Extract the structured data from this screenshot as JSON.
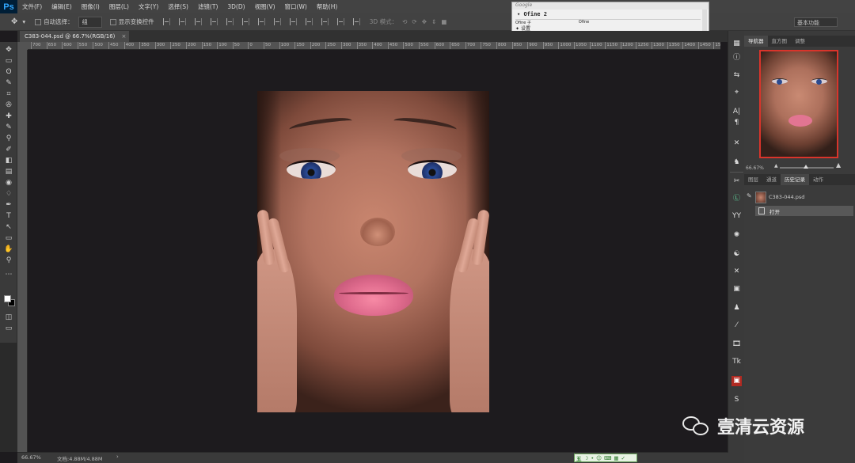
{
  "app": {
    "logo": "Ps"
  },
  "menu": [
    "文件(F)",
    "编辑(E)",
    "图像(I)",
    "图层(L)",
    "文字(Y)",
    "选择(S)",
    "滤镜(T)",
    "3D(D)",
    "视图(V)",
    "窗口(W)",
    "帮助(H)"
  ],
  "options": {
    "auto_select_label": "自动选择：",
    "auto_select_value": "组",
    "show_transform_label": "显示变换控件",
    "mode_3d": "3D 模式：",
    "workspace": "基本功能"
  },
  "ime": {
    "title": "Google",
    "composition": "Ofine 2",
    "candidates": [
      "Ofine 子",
      "Ofine"
    ],
    "settings": "设置"
  },
  "document": {
    "tab_title": "C383-044.psd @ 66.7%(RGB/16)",
    "close_icon": "×"
  },
  "ruler_ticks": [
    "700",
    "650",
    "600",
    "550",
    "500",
    "450",
    "400",
    "350",
    "300",
    "250",
    "200",
    "150",
    "100",
    "50",
    "0",
    "50",
    "100",
    "150",
    "200",
    "250",
    "300",
    "350",
    "400",
    "450",
    "500",
    "550",
    "600",
    "650",
    "700",
    "750",
    "800",
    "850",
    "900",
    "950",
    "1000",
    "1050",
    "1100",
    "1150",
    "1200",
    "1250",
    "1300",
    "1350",
    "1400",
    "1450",
    "1500"
  ],
  "panels": {
    "top_tabs": [
      "导航器",
      "直方图",
      "调整"
    ],
    "navigator_zoom": "66.67%",
    "bottom_tabs": [
      "图层",
      "通道",
      "历史记录",
      "动作"
    ],
    "history_file": "C383-044.psd",
    "history_step": "打开"
  },
  "status": {
    "zoom": "66.67%",
    "doc": "文档:4.88M/4.88M",
    "arrow": "›"
  },
  "ime_bar": [
    "五",
    "☽",
    "•",
    "☺",
    "⌨",
    "▦",
    "✓"
  ],
  "watermark": {
    "text": "壹清云资源"
  },
  "tools": [
    "✥",
    "▭",
    "ʘ",
    "✎",
    "⌗",
    "✇",
    "✚",
    "✎",
    "⚲",
    "✐",
    "◧",
    "▤",
    "◉",
    "♢",
    "✒",
    "T",
    "↖",
    "▭",
    "✋",
    "⚲",
    "⋯"
  ],
  "column_icons": [
    "▦",
    "ⓘ",
    "⇆",
    "⌖",
    "A|",
    "¶",
    "✕",
    "♞",
    "✂",
    "Ⓛ",
    "YY",
    "✺",
    "☯",
    "✕",
    "▣",
    "♟",
    "⁄",
    "🎞",
    "Tk",
    "▣",
    "S"
  ],
  "colors": {
    "accent_red": "#d9342b",
    "brand_blue": "#31a8ff"
  }
}
